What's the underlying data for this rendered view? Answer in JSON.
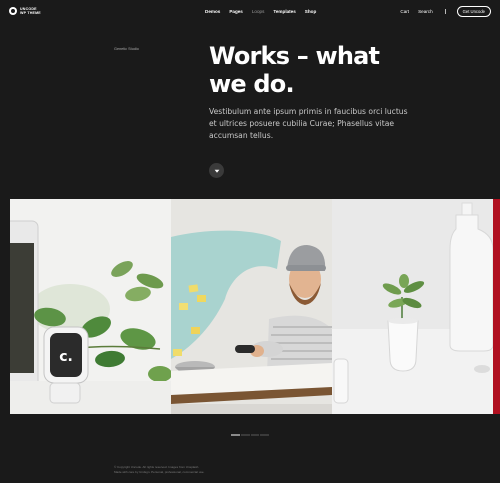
{
  "header": {
    "logo_lines": [
      "UNCODE",
      "WP THEME"
    ],
    "nav": [
      {
        "label": "Demos",
        "active": false
      },
      {
        "label": "Pages",
        "active": false
      },
      {
        "label": "Loops",
        "active": true
      },
      {
        "label": "Templates",
        "active": false
      },
      {
        "label": "Shop",
        "active": false
      }
    ],
    "right_links": [
      "Cart",
      "Search"
    ],
    "cta_label": "Get Uncode"
  },
  "breadcrumb": "Genetic Studio",
  "hero": {
    "title_line1": "Works – what",
    "title_line2": "we do.",
    "text": "Vestibulum ante ipsum primis in faucibus orci luctus et ultrices posuere cubilia Curae; Phasellus vitae accumsan tellus."
  },
  "scroll_icon": "chevron-down-icon",
  "footer": {
    "line1": "© Copyright Uncode. All rights reserved. Images from Unsplash.",
    "line2": "Made with care by Undsgn. Personal, professional, commercial use."
  },
  "colors": {
    "background": "#1a1a1a",
    "accent_red": "#b01020"
  }
}
